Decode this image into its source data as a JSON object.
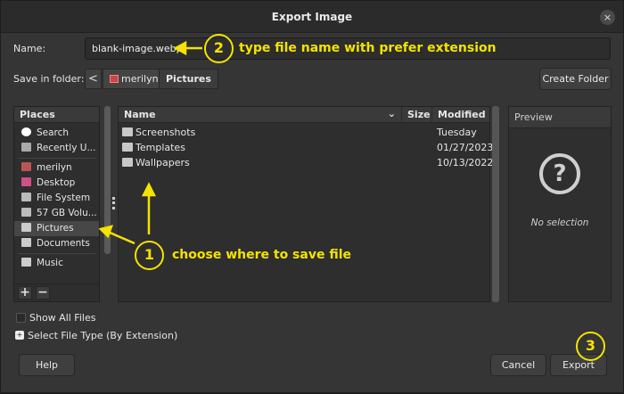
{
  "window": {
    "title": "Export Image",
    "close_glyph": "×"
  },
  "name_row": {
    "label": "Name:",
    "value": "blank-image.webp"
  },
  "folder_row": {
    "label": "Save in folder:",
    "back_glyph": "<",
    "crumbs": [
      {
        "label": "merilyn",
        "icon": "home-icon"
      },
      {
        "label": "Pictures"
      }
    ],
    "create_folder_label": "Create Folder"
  },
  "places": {
    "header": "Places",
    "items": [
      {
        "label": "Search",
        "icon": "search-icon"
      },
      {
        "label": "Recently U...",
        "icon": "recent-icon"
      },
      {
        "label": "merilyn",
        "icon": "home-icon"
      },
      {
        "label": "Desktop",
        "icon": "desktop-icon"
      },
      {
        "label": "File System",
        "icon": "drive-icon"
      },
      {
        "label": "57 GB Volu...",
        "icon": "drive-icon"
      },
      {
        "label": "Pictures",
        "icon": "folder-icon"
      },
      {
        "label": "Documents",
        "icon": "folder-icon"
      },
      {
        "label": "Music",
        "icon": "folder-icon"
      }
    ],
    "add_glyph": "+",
    "remove_glyph": "−"
  },
  "files": {
    "columns": {
      "name": "Name",
      "size": "Size",
      "modified": "Modified",
      "sort_glyph": "⌄"
    },
    "rows": [
      {
        "name": "Screenshots",
        "modified": "Tuesday"
      },
      {
        "name": "Templates",
        "modified": "01/27/2023"
      },
      {
        "name": "Wallpapers",
        "modified": "10/13/2022"
      }
    ]
  },
  "preview": {
    "header": "Preview",
    "icon_glyph": "?",
    "empty_text": "No selection"
  },
  "options": {
    "show_all_files": "Show All Files",
    "select_file_type": "Select File Type (By Extension)",
    "expander_glyph": "+"
  },
  "buttons": {
    "help": "Help",
    "cancel": "Cancel",
    "export": "Export"
  },
  "annotations": [
    {
      "number": "1",
      "text": "choose where to save file"
    },
    {
      "number": "2",
      "text": "type file name with prefer extension"
    },
    {
      "number": "3"
    }
  ],
  "colors": {
    "annotation": "#f4e300",
    "window_bg": "#353535",
    "selected_place": "#474747"
  }
}
